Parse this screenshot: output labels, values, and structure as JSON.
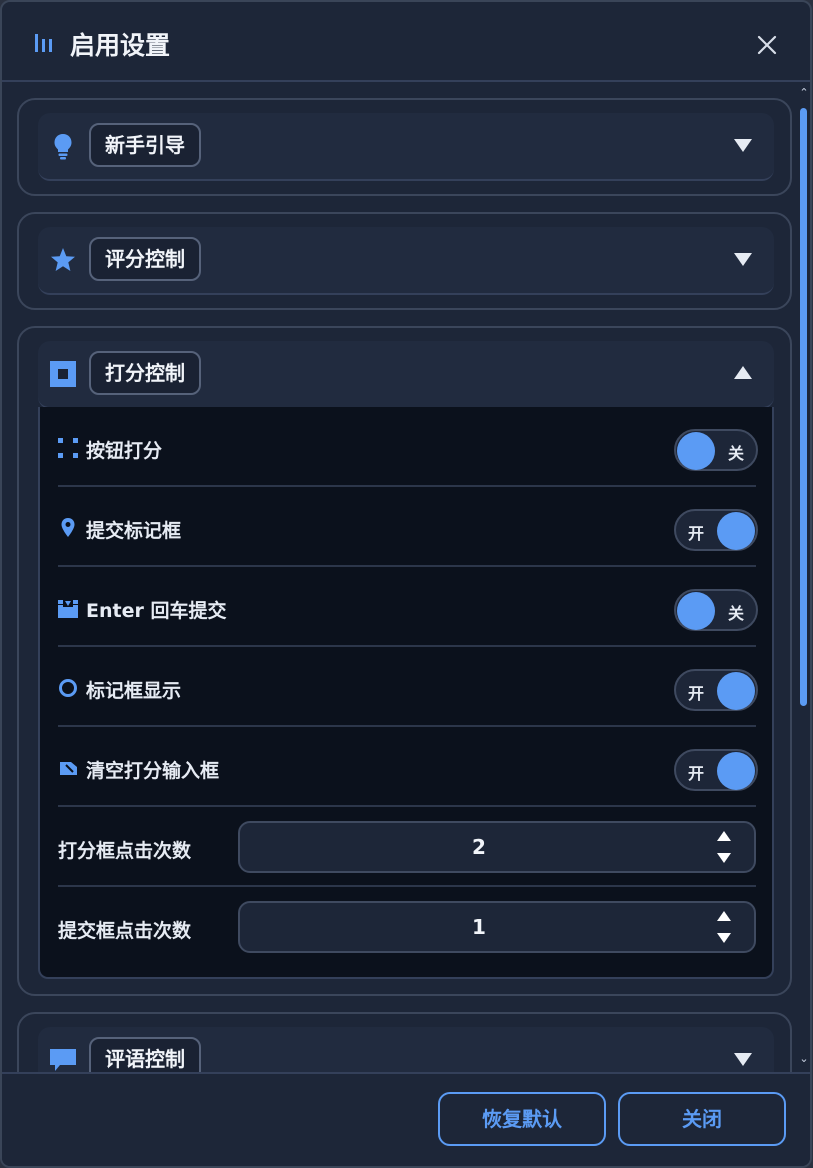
{
  "dialog": {
    "title": "启用设置",
    "accent": "#5b9bf4"
  },
  "sections": {
    "guide": {
      "label": "新手引导"
    },
    "rating": {
      "label": "评分控制"
    },
    "scoring": {
      "label": "打分控制",
      "rows": {
        "button_score": {
          "label": "按钮打分",
          "state": "关"
        },
        "submit_box": {
          "label": "提交标记框",
          "state": "开"
        },
        "enter_submit": {
          "label": "Enter 回车提交",
          "state": "关"
        },
        "box_display": {
          "label": "标记框显示",
          "state": "开"
        },
        "clear_input": {
          "label": "清空打分输入框",
          "state": "开"
        },
        "score_clicks": {
          "label": "打分框点击次数",
          "value": "2"
        },
        "submit_clicks": {
          "label": "提交框点击次数",
          "value": "1"
        }
      }
    },
    "comment": {
      "label": "评语控制"
    }
  },
  "footer": {
    "reset_label": "恢复默认",
    "close_label": "关闭"
  }
}
